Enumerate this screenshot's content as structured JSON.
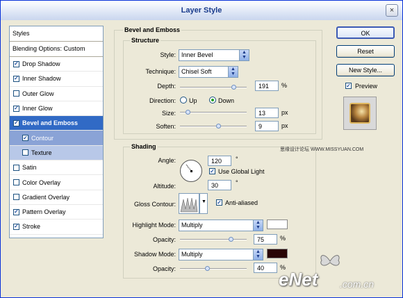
{
  "window": {
    "title": "Layer Style",
    "close_label": "×"
  },
  "left_panel": {
    "header": "Styles",
    "blending": "Blending Options: Custom",
    "items": [
      {
        "label": "Drop Shadow",
        "checked": true
      },
      {
        "label": "Inner Shadow",
        "checked": true
      },
      {
        "label": "Outer Glow",
        "checked": false
      },
      {
        "label": "Inner Glow",
        "checked": true
      },
      {
        "label": "Bevel and Emboss",
        "checked": true,
        "selected": true
      },
      {
        "label": "Contour",
        "checked": true,
        "sub": true,
        "active": true
      },
      {
        "label": "Texture",
        "checked": false,
        "sub": true
      },
      {
        "label": "Satin",
        "checked": false
      },
      {
        "label": "Color Overlay",
        "checked": false
      },
      {
        "label": "Gradient Overlay",
        "checked": false
      },
      {
        "label": "Pattern Overlay",
        "checked": true
      },
      {
        "label": "Stroke",
        "checked": true
      }
    ]
  },
  "bevel": {
    "section_title": "Bevel and Emboss",
    "structure_title": "Structure",
    "style_label": "Style:",
    "style_value": "Inner Bevel",
    "technique_label": "Technique:",
    "technique_value": "Chisel Soft",
    "depth_label": "Depth:",
    "depth_value": "191",
    "depth_unit": "%",
    "direction_label": "Direction:",
    "direction_up": "Up",
    "direction_down": "Down",
    "size_label": "Size:",
    "size_value": "13",
    "size_unit": "px",
    "soften_label": "Soften:",
    "soften_value": "9",
    "soften_unit": "px"
  },
  "shading": {
    "title": "Shading",
    "angle_label": "Angle:",
    "angle_value": "120",
    "angle_unit": "°",
    "global_light_label": "Use Global Light",
    "altitude_label": "Altitude:",
    "altitude_value": "30",
    "altitude_unit": "°",
    "gloss_label": "Gloss Contour:",
    "anti_aliased_label": "Anti-aliased",
    "highlight_mode_label": "Highlight Mode:",
    "highlight_mode_value": "Multiply",
    "highlight_color": "#ffffff",
    "highlight_opacity_label": "Opacity:",
    "highlight_opacity_value": "75",
    "highlight_opacity_unit": "%",
    "shadow_mode_label": "Shadow Mode:",
    "shadow_mode_value": "Multiply",
    "shadow_color": "#2a0505",
    "shadow_opacity_label": "Opacity:",
    "shadow_opacity_value": "40",
    "shadow_opacity_unit": "%"
  },
  "buttons": {
    "ok": "OK",
    "reset": "Reset",
    "new_style": "New Style...",
    "preview_label": "Preview"
  },
  "watermark": {
    "cn_text": "思缘设计论坛 WWW.MISSYUAN.COM",
    "brand": "eNet",
    "brand_suffix": ".com.cn"
  }
}
